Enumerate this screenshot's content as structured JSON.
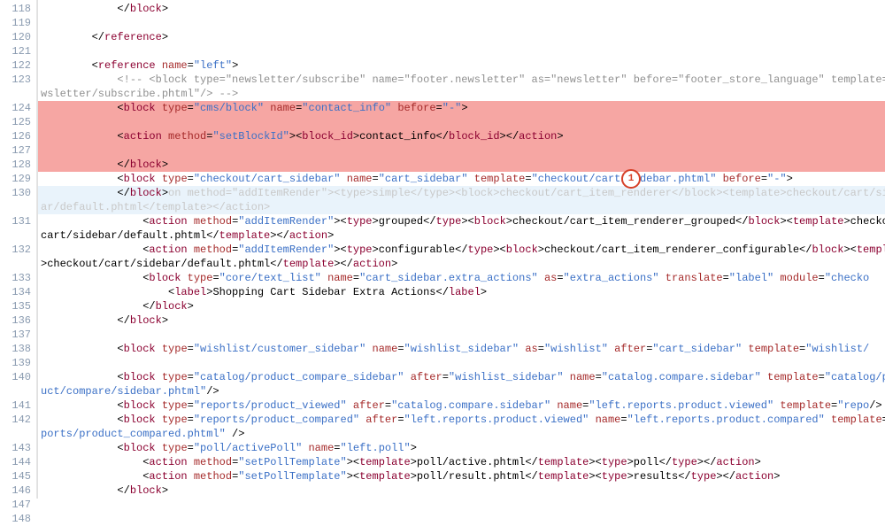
{
  "lines": [
    {
      "n": 118,
      "indent": 12,
      "tokens": [
        [
          "punct",
          "</"
        ],
        [
          "tag",
          "block"
        ],
        [
          "punct",
          ">"
        ]
      ]
    },
    {
      "n": 119,
      "tokens": []
    },
    {
      "n": 120,
      "indent": 8,
      "tokens": [
        [
          "punct",
          "</"
        ],
        [
          "tag",
          "reference"
        ],
        [
          "punct",
          ">"
        ]
      ]
    },
    {
      "n": 121,
      "tokens": []
    },
    {
      "n": 122,
      "indent": 8,
      "tokens": [
        [
          "punct",
          "<"
        ],
        [
          "tag",
          "reference"
        ],
        [
          "txt",
          " "
        ],
        [
          "attr",
          "name"
        ],
        [
          "punct",
          "="
        ],
        [
          "val",
          "\"left\""
        ],
        [
          "punct",
          ">"
        ]
      ]
    },
    {
      "n": 123,
      "indent": 12,
      "tokens": [
        [
          "comment",
          "<!-- <block type=\"newsletter/subscribe\" name=\"footer.newsletter\" as=\"newsletter\" before=\"footer_store_language\" template=\"newsletter/subscribe.phtml\"/> -->"
        ]
      ],
      "wrapIndent": 0
    },
    {
      "n": 124,
      "indent": 12,
      "hl": true,
      "tokens": [
        [
          "punct",
          "<"
        ],
        [
          "tag",
          "block"
        ],
        [
          "txt",
          " "
        ],
        [
          "attr",
          "type"
        ],
        [
          "punct",
          "="
        ],
        [
          "val",
          "\"cms/block\""
        ],
        [
          "txt",
          " "
        ],
        [
          "attr",
          "name"
        ],
        [
          "punct",
          "="
        ],
        [
          "val",
          "\"contact_info\""
        ],
        [
          "txt",
          " "
        ],
        [
          "attr",
          "before"
        ],
        [
          "punct",
          "="
        ],
        [
          "val",
          "\"-\""
        ],
        [
          "punct",
          ">"
        ]
      ]
    },
    {
      "n": 125,
      "hl": true,
      "tokens": []
    },
    {
      "n": 126,
      "indent": 12,
      "hl": true,
      "tokens": [
        [
          "punct",
          "<"
        ],
        [
          "tag",
          "action"
        ],
        [
          "txt",
          " "
        ],
        [
          "attr",
          "method"
        ],
        [
          "punct",
          "="
        ],
        [
          "val",
          "\"setBlockId\""
        ],
        [
          "punct",
          "><"
        ],
        [
          "tag",
          "block_id"
        ],
        [
          "punct",
          ">"
        ],
        [
          "txt",
          "contact_info"
        ],
        [
          "punct",
          "</"
        ],
        [
          "tag",
          "block_id"
        ],
        [
          "punct",
          "></"
        ],
        [
          "tag",
          "action"
        ],
        [
          "punct",
          ">"
        ]
      ]
    },
    {
      "n": 127,
      "hl": true,
      "tokens": []
    },
    {
      "n": 128,
      "indent": 12,
      "hl": true,
      "tokens": [
        [
          "punct",
          "</"
        ],
        [
          "tag",
          "block"
        ],
        [
          "punct",
          ">"
        ]
      ]
    },
    {
      "n": 129,
      "indent": 12,
      "tokens": [
        [
          "punct",
          "<"
        ],
        [
          "tag",
          "block"
        ],
        [
          "txt",
          " "
        ],
        [
          "attr",
          "type"
        ],
        [
          "punct",
          "="
        ],
        [
          "val",
          "\"checkout/cart_sidebar\""
        ],
        [
          "txt",
          " "
        ],
        [
          "attr",
          "name"
        ],
        [
          "punct",
          "="
        ],
        [
          "val",
          "\"cart_sidebar\""
        ],
        [
          "txt",
          " "
        ],
        [
          "attr",
          "template"
        ],
        [
          "punct",
          "="
        ],
        [
          "val",
          "\"checkout/cart/sidebar.phtml\""
        ],
        [
          "txt",
          " "
        ],
        [
          "attr",
          "before"
        ],
        [
          "punct",
          "="
        ],
        [
          "val",
          "\"-\""
        ],
        [
          "punct",
          ">"
        ]
      ]
    },
    {
      "n": 130,
      "indent": 12,
      "cursor": true,
      "tokens": [
        [
          "punct",
          "</"
        ],
        [
          "tag",
          "block"
        ],
        [
          "punct",
          ">"
        ],
        [
          "faded",
          "on method=\"addItemRender\"><type>simple</type><block>checkout/cart_item_renderer</block><template>checkout/cart/sidebar/default.phtml</template></action>"
        ]
      ],
      "wrapIndent": 0
    },
    {
      "n": 131,
      "indent": 16,
      "tokens": [
        [
          "punct",
          "<"
        ],
        [
          "tag",
          "action"
        ],
        [
          "txt",
          " "
        ],
        [
          "attr",
          "method"
        ],
        [
          "punct",
          "="
        ],
        [
          "val",
          "\"addItemRender\""
        ],
        [
          "punct",
          "><"
        ],
        [
          "tag",
          "type"
        ],
        [
          "punct",
          ">"
        ],
        [
          "txt",
          "grouped"
        ],
        [
          "punct",
          "</"
        ],
        [
          "tag",
          "type"
        ],
        [
          "punct",
          "><"
        ],
        [
          "tag",
          "block"
        ],
        [
          "punct",
          ">"
        ],
        [
          "txt",
          "checkout/cart_item_renderer_grouped"
        ],
        [
          "punct",
          "</"
        ],
        [
          "tag",
          "block"
        ],
        [
          "punct",
          "><"
        ],
        [
          "tag",
          "template"
        ],
        [
          "punct",
          ">"
        ],
        [
          "txt",
          "checkout/cart/sidebar/default.phtml"
        ],
        [
          "punct",
          "</"
        ],
        [
          "tag",
          "template"
        ],
        [
          "punct",
          "></"
        ],
        [
          "tag",
          "action"
        ],
        [
          "punct",
          ">"
        ]
      ],
      "wrapIndent": 0
    },
    {
      "n": 132,
      "indent": 16,
      "tokens": [
        [
          "punct",
          "<"
        ],
        [
          "tag",
          "action"
        ],
        [
          "txt",
          " "
        ],
        [
          "attr",
          "method"
        ],
        [
          "punct",
          "="
        ],
        [
          "val",
          "\"addItemRender\""
        ],
        [
          "punct",
          "><"
        ],
        [
          "tag",
          "type"
        ],
        [
          "punct",
          ">"
        ],
        [
          "txt",
          "configurable"
        ],
        [
          "punct",
          "</"
        ],
        [
          "tag",
          "type"
        ],
        [
          "punct",
          "><"
        ],
        [
          "tag",
          "block"
        ],
        [
          "punct",
          ">"
        ],
        [
          "txt",
          "checkout/cart_item_renderer_configurable"
        ],
        [
          "punct",
          "</"
        ],
        [
          "tag",
          "block"
        ],
        [
          "punct",
          "><"
        ],
        [
          "tag",
          "template"
        ],
        [
          "punct",
          ">"
        ],
        [
          "txt",
          "checkout/cart/sidebar/default.phtml"
        ],
        [
          "punct",
          "</"
        ],
        [
          "tag",
          "template"
        ],
        [
          "punct",
          "></"
        ],
        [
          "tag",
          "action"
        ],
        [
          "punct",
          ">"
        ]
      ],
      "wrapIndent": 0
    },
    {
      "n": 133,
      "indent": 16,
      "tokens": [
        [
          "punct",
          "<"
        ],
        [
          "tag",
          "block"
        ],
        [
          "txt",
          " "
        ],
        [
          "attr",
          "type"
        ],
        [
          "punct",
          "="
        ],
        [
          "val",
          "\"core/text_list\""
        ],
        [
          "txt",
          " "
        ],
        [
          "attr",
          "name"
        ],
        [
          "punct",
          "="
        ],
        [
          "val",
          "\"cart_sidebar.extra_actions\""
        ],
        [
          "txt",
          " "
        ],
        [
          "attr",
          "as"
        ],
        [
          "punct",
          "="
        ],
        [
          "val",
          "\"extra_actions\""
        ],
        [
          "txt",
          " "
        ],
        [
          "attr",
          "translate"
        ],
        [
          "punct",
          "="
        ],
        [
          "val",
          "\"label\""
        ],
        [
          "txt",
          " "
        ],
        [
          "attr",
          "module"
        ],
        [
          "punct",
          "="
        ],
        [
          "val",
          "\"checko"
        ]
      ]
    },
    {
      "n": 134,
      "indent": 20,
      "tokens": [
        [
          "punct",
          "<"
        ],
        [
          "tag",
          "label"
        ],
        [
          "punct",
          ">"
        ],
        [
          "txt",
          "Shopping Cart Sidebar Extra Actions"
        ],
        [
          "punct",
          "</"
        ],
        [
          "tag",
          "label"
        ],
        [
          "punct",
          ">"
        ]
      ]
    },
    {
      "n": 135,
      "indent": 16,
      "tokens": [
        [
          "punct",
          "</"
        ],
        [
          "tag",
          "block"
        ],
        [
          "punct",
          ">"
        ]
      ]
    },
    {
      "n": 136,
      "indent": 12,
      "tokens": [
        [
          "punct",
          "</"
        ],
        [
          "tag",
          "block"
        ],
        [
          "punct",
          ">"
        ]
      ]
    },
    {
      "n": 137,
      "tokens": []
    },
    {
      "n": 138,
      "indent": 12,
      "tokens": [
        [
          "punct",
          "<"
        ],
        [
          "tag",
          "block"
        ],
        [
          "txt",
          " "
        ],
        [
          "attr",
          "type"
        ],
        [
          "punct",
          "="
        ],
        [
          "val",
          "\"wishlist/customer_sidebar\""
        ],
        [
          "txt",
          " "
        ],
        [
          "attr",
          "name"
        ],
        [
          "punct",
          "="
        ],
        [
          "val",
          "\"wishlist_sidebar\""
        ],
        [
          "txt",
          " "
        ],
        [
          "attr",
          "as"
        ],
        [
          "punct",
          "="
        ],
        [
          "val",
          "\"wishlist\""
        ],
        [
          "txt",
          " "
        ],
        [
          "attr",
          "after"
        ],
        [
          "punct",
          "="
        ],
        [
          "val",
          "\"cart_sidebar\""
        ],
        [
          "txt",
          " "
        ],
        [
          "attr",
          "template"
        ],
        [
          "punct",
          "="
        ],
        [
          "val",
          "\"wishlist/"
        ]
      ]
    },
    {
      "n": 139,
      "tokens": []
    },
    {
      "n": 140,
      "indent": 12,
      "tokens": [
        [
          "punct",
          "<"
        ],
        [
          "tag",
          "block"
        ],
        [
          "txt",
          " "
        ],
        [
          "attr",
          "type"
        ],
        [
          "punct",
          "="
        ],
        [
          "val",
          "\"catalog/product_compare_sidebar\""
        ],
        [
          "txt",
          " "
        ],
        [
          "attr",
          "after"
        ],
        [
          "punct",
          "="
        ],
        [
          "val",
          "\"wishlist_sidebar\""
        ],
        [
          "txt",
          " "
        ],
        [
          "attr",
          "name"
        ],
        [
          "punct",
          "="
        ],
        [
          "val",
          "\"catalog.compare.sidebar\""
        ],
        [
          "txt",
          " "
        ],
        [
          "attr",
          "template"
        ],
        [
          "punct",
          "="
        ],
        [
          "val",
          "\"catalog/product/compare/sidebar.phtml\""
        ],
        [
          "punct",
          "/>"
        ]
      ],
      "wrapIndent": 0
    },
    {
      "n": 141,
      "indent": 12,
      "tokens": [
        [
          "punct",
          "<"
        ],
        [
          "tag",
          "block"
        ],
        [
          "txt",
          " "
        ],
        [
          "attr",
          "type"
        ],
        [
          "punct",
          "="
        ],
        [
          "val",
          "\"reports/product_viewed\""
        ],
        [
          "txt",
          " "
        ],
        [
          "attr",
          "after"
        ],
        [
          "punct",
          "="
        ],
        [
          "val",
          "\"catalog.compare.sidebar\""
        ],
        [
          "txt",
          " "
        ],
        [
          "attr",
          "name"
        ],
        [
          "punct",
          "="
        ],
        [
          "val",
          "\"left.reports.product.viewed\""
        ],
        [
          "txt",
          " "
        ],
        [
          "attr",
          "template"
        ],
        [
          "punct",
          "="
        ],
        [
          "val",
          "\"repo"
        ],
        [
          "punct",
          "/>"
        ]
      ],
      "wrapIndent": 0
    },
    {
      "n": 142,
      "indent": 12,
      "tokens": [
        [
          "punct",
          "<"
        ],
        [
          "tag",
          "block"
        ],
        [
          "txt",
          " "
        ],
        [
          "attr",
          "type"
        ],
        [
          "punct",
          "="
        ],
        [
          "val",
          "\"reports/product_compared\""
        ],
        [
          "txt",
          " "
        ],
        [
          "attr",
          "after"
        ],
        [
          "punct",
          "="
        ],
        [
          "val",
          "\"left.reports.product.viewed\""
        ],
        [
          "txt",
          " "
        ],
        [
          "attr",
          "name"
        ],
        [
          "punct",
          "="
        ],
        [
          "val",
          "\"left.reports.product.compared\""
        ],
        [
          "txt",
          " "
        ],
        [
          "attr",
          "template"
        ],
        [
          "punct",
          "="
        ],
        [
          "val",
          "\"reports/product_compared.phtml\""
        ],
        [
          "txt",
          " "
        ],
        [
          "punct",
          "/>"
        ]
      ],
      "wrapIndent": 0
    },
    {
      "n": 143,
      "indent": 12,
      "tokens": [
        [
          "punct",
          "<"
        ],
        [
          "tag",
          "block"
        ],
        [
          "txt",
          " "
        ],
        [
          "attr",
          "type"
        ],
        [
          "punct",
          "="
        ],
        [
          "val",
          "\"poll/activePoll\""
        ],
        [
          "txt",
          " "
        ],
        [
          "attr",
          "name"
        ],
        [
          "punct",
          "="
        ],
        [
          "val",
          "\"left.poll\""
        ],
        [
          "punct",
          ">"
        ]
      ]
    },
    {
      "n": 144,
      "indent": 16,
      "tokens": [
        [
          "punct",
          "<"
        ],
        [
          "tag",
          "action"
        ],
        [
          "txt",
          " "
        ],
        [
          "attr",
          "method"
        ],
        [
          "punct",
          "="
        ],
        [
          "val",
          "\"setPollTemplate\""
        ],
        [
          "punct",
          "><"
        ],
        [
          "tag",
          "template"
        ],
        [
          "punct",
          ">"
        ],
        [
          "txt",
          "poll/active.phtml"
        ],
        [
          "punct",
          "</"
        ],
        [
          "tag",
          "template"
        ],
        [
          "punct",
          "><"
        ],
        [
          "tag",
          "type"
        ],
        [
          "punct",
          ">"
        ],
        [
          "txt",
          "poll"
        ],
        [
          "punct",
          "</"
        ],
        [
          "tag",
          "type"
        ],
        [
          "punct",
          "></"
        ],
        [
          "tag",
          "action"
        ],
        [
          "punct",
          ">"
        ]
      ]
    },
    {
      "n": 145,
      "indent": 16,
      "tokens": [
        [
          "punct",
          "<"
        ],
        [
          "tag",
          "action"
        ],
        [
          "txt",
          " "
        ],
        [
          "attr",
          "method"
        ],
        [
          "punct",
          "="
        ],
        [
          "val",
          "\"setPollTemplate\""
        ],
        [
          "punct",
          "><"
        ],
        [
          "tag",
          "template"
        ],
        [
          "punct",
          ">"
        ],
        [
          "txt",
          "poll/result.phtml"
        ],
        [
          "punct",
          "</"
        ],
        [
          "tag",
          "template"
        ],
        [
          "punct",
          "><"
        ],
        [
          "tag",
          "type"
        ],
        [
          "punct",
          ">"
        ],
        [
          "txt",
          "results"
        ],
        [
          "punct",
          "</"
        ],
        [
          "tag",
          "type"
        ],
        [
          "punct",
          "></"
        ],
        [
          "tag",
          "action"
        ],
        [
          "punct",
          ">"
        ]
      ]
    },
    {
      "n": 146,
      "indent": 12,
      "tokens": [
        [
          "punct",
          "</"
        ],
        [
          "tag",
          "block"
        ],
        [
          "punct",
          ">"
        ]
      ]
    },
    {
      "n": 147,
      "tokens": []
    },
    {
      "n": 148,
      "tokens": []
    }
  ],
  "annotation": {
    "number": "1",
    "line": 129,
    "col": 660
  }
}
